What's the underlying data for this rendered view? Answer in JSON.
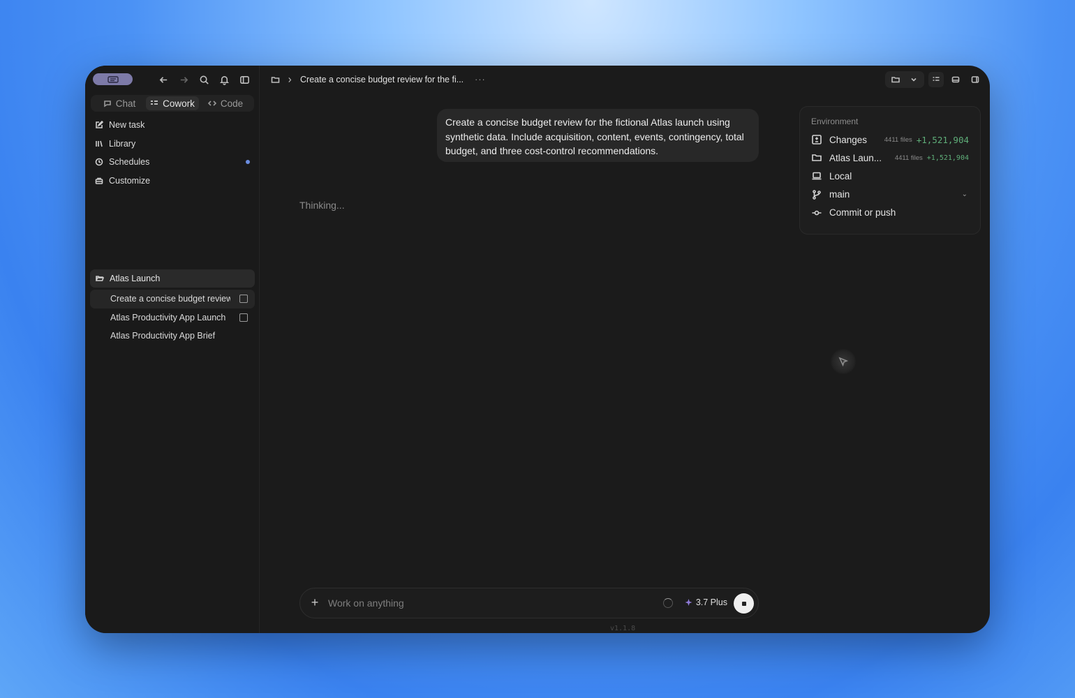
{
  "sidebar": {
    "modes": [
      {
        "label": "Chat",
        "icon": "chat-icon"
      },
      {
        "label": "Cowork",
        "icon": "cowork-icon"
      },
      {
        "label": "Code",
        "icon": "code-icon"
      }
    ],
    "active_mode": "Cowork",
    "nav": [
      {
        "label": "New task",
        "icon": "edit-icon"
      },
      {
        "label": "Library",
        "icon": "library-icon"
      },
      {
        "label": "Schedules",
        "icon": "clock-icon"
      },
      {
        "label": "Customize",
        "icon": "briefcase-icon"
      }
    ],
    "project": {
      "label": "Atlas Launch",
      "icon": "folder-open-icon"
    },
    "tasks": [
      {
        "label": "Create a concise budget review for the fictional Atlas launch"
      },
      {
        "label": "Atlas Productivity App Launch"
      },
      {
        "label": "Atlas Productivity App Brief"
      }
    ]
  },
  "header": {
    "breadcrumb_title": "Create a concise budget review for the fi...",
    "more": "···"
  },
  "chat": {
    "user_message": "Create a concise budget review for the fictional Atlas launch using synthetic data. Include acquisition, content, events, contingency, total budget, and three cost-control recommendations.",
    "status": "Thinking..."
  },
  "environment": {
    "title": "Environment",
    "rows": [
      {
        "label": "Changes",
        "files": "4411 files",
        "delta": "+1,521,904",
        "icon": "diff-icon"
      },
      {
        "label": "Atlas Laun...",
        "files": "4411 files",
        "delta": "+1,521,904",
        "icon": "folder-icon"
      },
      {
        "label": "Local",
        "icon": "laptop-icon"
      },
      {
        "label": "main",
        "icon": "branch-icon"
      },
      {
        "label": "Commit or push",
        "icon": "commit-icon"
      }
    ]
  },
  "composer": {
    "placeholder": "Work on anything",
    "model": "3.7 Plus"
  },
  "version": "v1.1.8",
  "colors": {
    "window_bg": "#1b1b1b",
    "accent_badge": "#7d7aa8",
    "delta_green": "#5fae79"
  }
}
